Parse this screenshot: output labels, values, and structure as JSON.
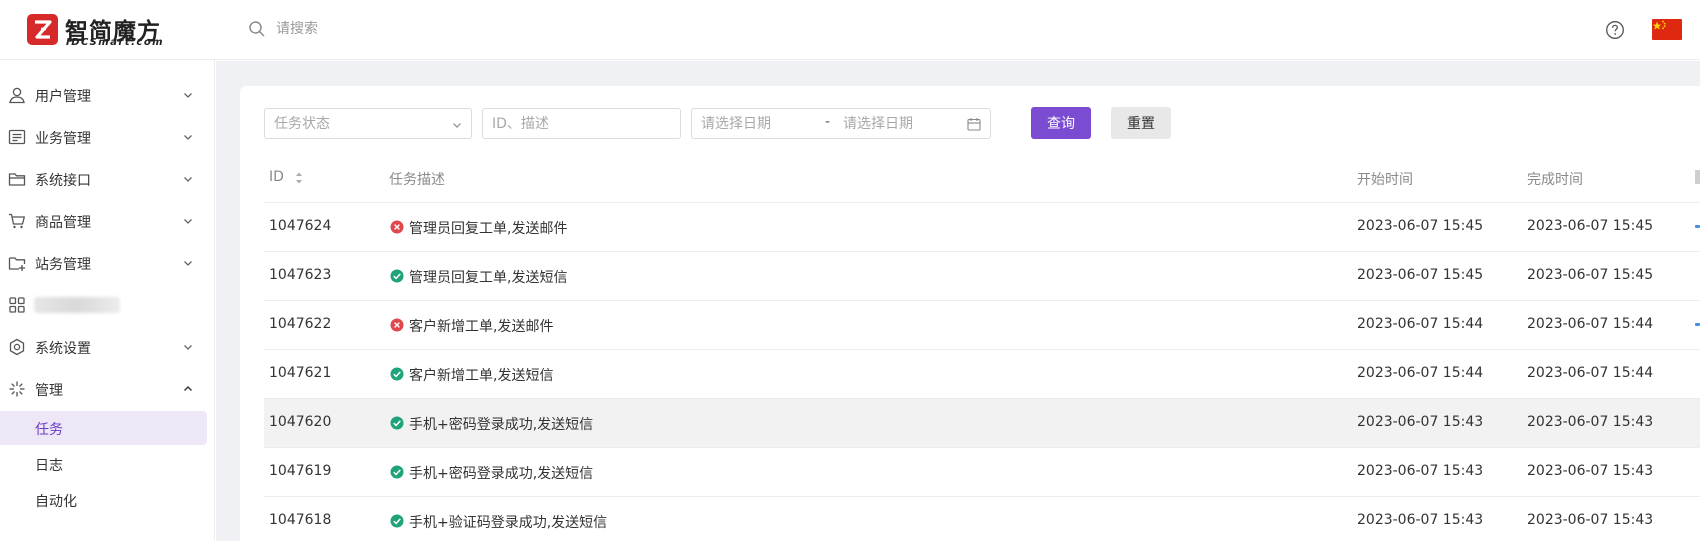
{
  "app": {
    "logo_cn": "智简魔方",
    "logo_en": "IDCSmart.com",
    "search_placeholder": "请搜索"
  },
  "colors": {
    "accent": "#7b4bd1",
    "success": "#1ea37a",
    "error": "#e0474f",
    "brand": "#d62a2a"
  },
  "sidebar": {
    "items": [
      {
        "label": "用户管理",
        "icon": "user-icon"
      },
      {
        "label": "业务管理",
        "icon": "list-icon"
      },
      {
        "label": "系统接口",
        "icon": "folder-icon"
      },
      {
        "label": "商品管理",
        "icon": "cart-icon"
      },
      {
        "label": "站务管理",
        "icon": "folder-plus-icon"
      },
      {
        "label": "",
        "icon": "apps-icon"
      },
      {
        "label": "系统设置",
        "icon": "settings-icon"
      },
      {
        "label": "管理",
        "icon": "manage-icon"
      }
    ],
    "sub_items": [
      "任务",
      "日志",
      "自动化"
    ],
    "active_sub": "任务"
  },
  "filters": {
    "status_placeholder": "任务状态",
    "id_placeholder": "ID、描述",
    "date_start_placeholder": "请选择日期",
    "date_sep": "-",
    "date_end_placeholder": "请选择日期",
    "query_label": "查询",
    "reset_label": "重置"
  },
  "table": {
    "columns": [
      "ID",
      "任务描述",
      "开始时间",
      "完成时间"
    ],
    "rows": [
      {
        "id": "1047624",
        "status": "error",
        "desc": "管理员回复工单,发送邮件",
        "start": "2023-06-07 15:45",
        "end": "2023-06-07 15:45"
      },
      {
        "id": "1047623",
        "status": "success",
        "desc": "管理员回复工单,发送短信",
        "start": "2023-06-07 15:45",
        "end": "2023-06-07 15:45"
      },
      {
        "id": "1047622",
        "status": "error",
        "desc": "客户新增工单,发送邮件",
        "start": "2023-06-07 15:44",
        "end": "2023-06-07 15:44"
      },
      {
        "id": "1047621",
        "status": "success",
        "desc": "客户新增工单,发送短信",
        "start": "2023-06-07 15:44",
        "end": "2023-06-07 15:44"
      },
      {
        "id": "1047620",
        "status": "success",
        "desc": "手机+密码登录成功,发送短信",
        "start": "2023-06-07 15:43",
        "end": "2023-06-07 15:43"
      },
      {
        "id": "1047619",
        "status": "success",
        "desc": "手机+密码登录成功,发送短信",
        "start": "2023-06-07 15:43",
        "end": "2023-06-07 15:43"
      },
      {
        "id": "1047618",
        "status": "success",
        "desc": "手机+验证码登录成功,发送短信",
        "start": "2023-06-07 15:43",
        "end": "2023-06-07 15:43"
      }
    ]
  }
}
